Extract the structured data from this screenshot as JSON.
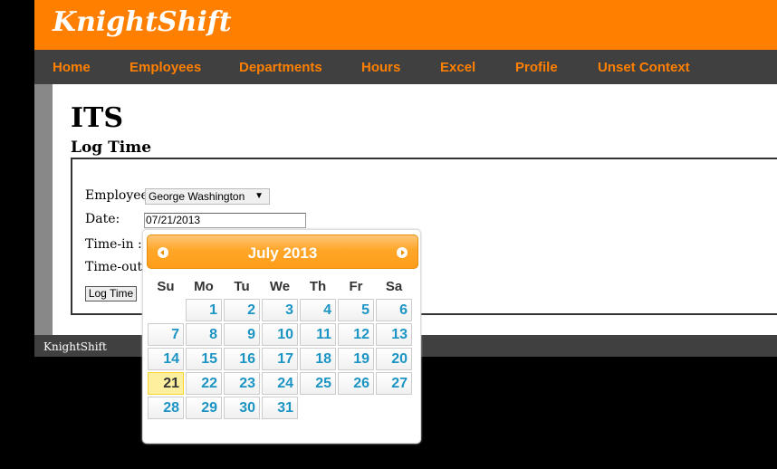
{
  "app": {
    "brand": "KnightShift"
  },
  "nav": {
    "items": [
      "Home",
      "Employees",
      "Departments",
      "Hours",
      "Excel",
      "Profile",
      "Unset Context"
    ]
  },
  "page": {
    "title": "ITS",
    "subtitle": "Log Time"
  },
  "form": {
    "employee_label": "Employee:",
    "employee_value": "George Washington",
    "date_label": "Date:",
    "date_value": "07/21/2013",
    "timein_label": "Time-in :",
    "timeout_label": "Time-out :",
    "submit_label": "Log Time"
  },
  "footer": {
    "text": "KnightShift"
  },
  "datepicker": {
    "month": "July",
    "year": "2013",
    "prev_icon": "chevron-left-icon",
    "next_icon": "chevron-right-icon",
    "weekdays": [
      "Su",
      "Mo",
      "Tu",
      "We",
      "Th",
      "Fr",
      "Sa"
    ],
    "weeks": [
      [
        "",
        "1",
        "2",
        "3",
        "4",
        "5",
        "6"
      ],
      [
        "7",
        "8",
        "9",
        "10",
        "11",
        "12",
        "13"
      ],
      [
        "14",
        "15",
        "16",
        "17",
        "18",
        "19",
        "20"
      ],
      [
        "21",
        "22",
        "23",
        "24",
        "25",
        "26",
        "27"
      ],
      [
        "28",
        "29",
        "30",
        "31",
        "",
        "",
        ""
      ]
    ],
    "today": "21",
    "colors": {
      "header": "#ff9d1a",
      "day_text": "#1c94c4",
      "today_bg": "#fcf09e"
    }
  },
  "colors": {
    "brand_orange": "#ff8000",
    "nav_bg": "#404040"
  }
}
